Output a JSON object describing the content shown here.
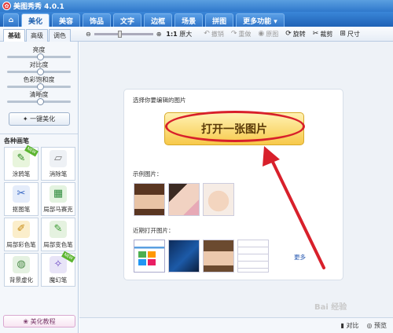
{
  "app": {
    "title": "美图秀秀 4.0.1"
  },
  "tabs": [
    "美化",
    "美容",
    "饰品",
    "文字",
    "边框",
    "场景",
    "拼图",
    "更多功能 ▾"
  ],
  "toolbar": {
    "left_tabs": [
      "基础",
      "高级",
      "调色"
    ],
    "zoom_reset": "1:1",
    "zoom_fit": "原大",
    "rotate": "旋转",
    "cut": "裁剪",
    "size": "尺寸",
    "undo": "撤销",
    "redo": "重做",
    "original": "原图"
  },
  "left": {
    "sliders": [
      "亮度",
      "对比度",
      "色彩饱和度",
      "清晰度"
    ],
    "one_key": "一键美化",
    "brush_header": "各种画笔",
    "brushes": [
      "涂鸦笔",
      "消除笔",
      "抠图笔",
      "局部马赛克",
      "局部彩色笔",
      "局部变色笔",
      "背景虚化",
      "魔幻笔"
    ],
    "tutorial": "美化教程"
  },
  "main": {
    "card_title": "选择你要编辑的图片",
    "open_button": "打开一张图片",
    "sample_label": "示例图片：",
    "recent_label": "近期打开图片：",
    "more": "更多"
  },
  "status": {
    "compare": "对比",
    "preview": "预览"
  },
  "watermark": "Bai 经验"
}
